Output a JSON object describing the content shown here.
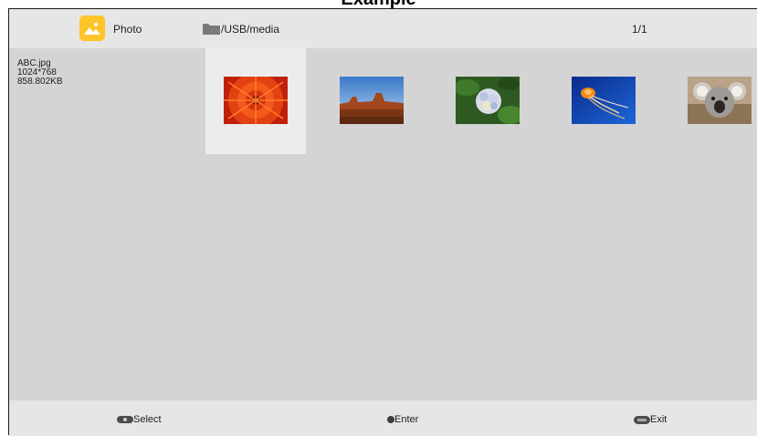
{
  "page_heading": "Example",
  "header": {
    "app_icon": "photo-app-icon",
    "app_label": "Photo",
    "folder_icon": "folder-icon",
    "path": "/USB/media",
    "page_indicator": "1/1"
  },
  "file_info": {
    "name": "ABC.jpg",
    "resolution": "1024*768",
    "size": "858.802KB"
  },
  "thumbnails": [
    {
      "subject": "red-flower",
      "selected": true
    },
    {
      "subject": "desert-mesa",
      "selected": false
    },
    {
      "subject": "hydrangea",
      "selected": false
    },
    {
      "subject": "jellyfish",
      "selected": false
    },
    {
      "subject": "koala",
      "selected": false
    }
  ],
  "footer": {
    "select_label": "Select",
    "enter_label": "Enter",
    "exit_label": "Exit",
    "select_icon": "dpad-icon",
    "enter_icon": "ok-dot-icon",
    "exit_icon": "exit-key-icon"
  },
  "colors": {
    "screen_bg": "#d4d4d4",
    "bar_bg": "#e6e6e6",
    "selected_bg": "#ececec",
    "app_icon": "#ffc42a"
  }
}
